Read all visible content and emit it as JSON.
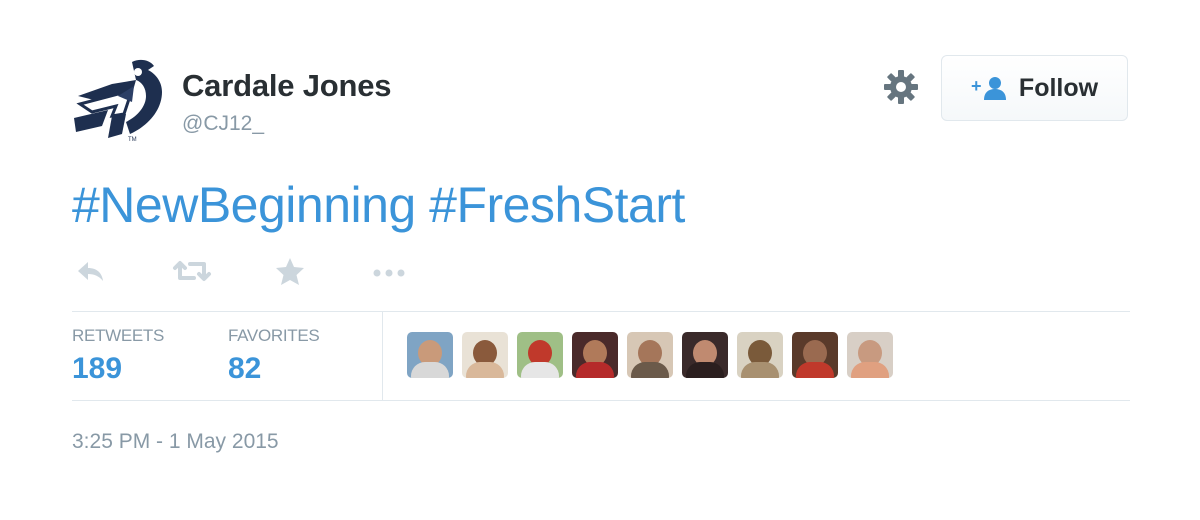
{
  "user": {
    "display_name": "Cardale Jones",
    "handle": "@CJ12_",
    "avatar_icon": "team-logo-icon"
  },
  "header": {
    "settings_icon": "gear-icon",
    "follow_label": "Follow",
    "follow_icon": "add-user-icon"
  },
  "tweet": {
    "hashtags": [
      "#NewBeginning",
      "#FreshStart"
    ]
  },
  "actions": [
    {
      "name": "reply",
      "icon": "reply-icon"
    },
    {
      "name": "retweet",
      "icon": "retweet-icon"
    },
    {
      "name": "favorite",
      "icon": "star-icon"
    },
    {
      "name": "more",
      "icon": "more-icon"
    }
  ],
  "stats": {
    "retweets_label": "RETWEETS",
    "retweets_count": "189",
    "favorites_label": "FAVORITES",
    "favorites_count": "82"
  },
  "favoriters_count_shown": 9,
  "timestamp": "3:25 PM - 1 May 2015",
  "colors": {
    "link": "#3b94d9",
    "text": "#292f33",
    "muted": "#8899a6",
    "icon": "#ccd6dd",
    "border": "#e1e8ed"
  }
}
